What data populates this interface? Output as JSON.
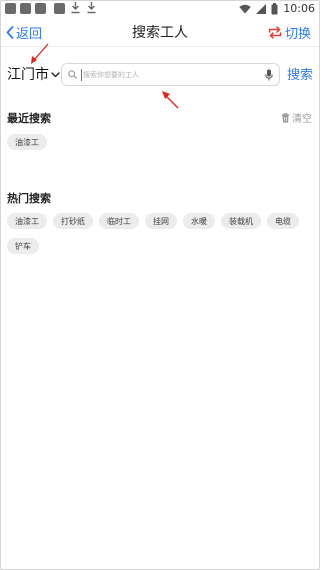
{
  "statusbar": {
    "time": "10:06"
  },
  "nav": {
    "back_label": "返回",
    "title": "搜索工人",
    "switch_label": "切换"
  },
  "search": {
    "city": "江门市",
    "placeholder": "搜索你想要的工人",
    "button": "搜索"
  },
  "recent": {
    "title": "最近搜索",
    "clear_label": "清空",
    "items": [
      "油漆工"
    ]
  },
  "hot": {
    "title": "热门搜索",
    "items": [
      "油漆工",
      "打砂纸",
      "临时工",
      "挂网",
      "水暖",
      "装载机",
      "电缆",
      "铲车"
    ]
  },
  "colors": {
    "accent": "#2f7cf6",
    "chip_bg": "#ececec",
    "arrow": "#e0261c"
  }
}
